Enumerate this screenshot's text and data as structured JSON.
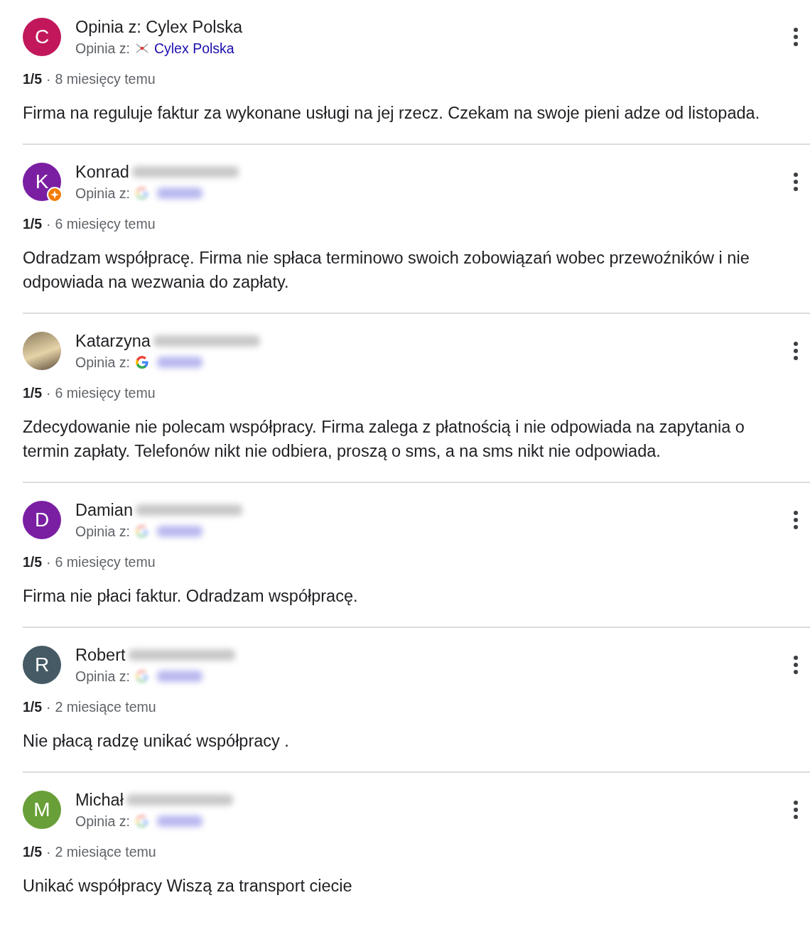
{
  "reviews": [
    {
      "avatar": {
        "kind": "letter",
        "letter": "C",
        "color": "#c2185b"
      },
      "name": "Opinia z: Cylex Polska",
      "source": {
        "label": "Opinia z:",
        "kind": "cylex",
        "name": "Cylex Polska"
      },
      "rating": "1/5",
      "separator": "·",
      "time": "8 miesięcy temu",
      "text": "Firma na reguluje faktur za wykonane usługi na jej rzecz. Czekam na swoje pieni adze od listopada."
    },
    {
      "avatar": {
        "kind": "letter",
        "letter": "K",
        "color": "#7b1fa2",
        "badge": true
      },
      "name": "Konrad",
      "surname_blurred": true,
      "source": {
        "label": "Opinia z:",
        "kind": "google",
        "blurred": true
      },
      "rating": "1/5",
      "separator": "·",
      "time": "6 miesięcy temu",
      "text": "Odradzam współpracę. Firma nie spłaca terminowo swoich zobowiązań wobec przewoźników i nie odpowiada na wezwania do zapłaty."
    },
    {
      "avatar": {
        "kind": "photo"
      },
      "name": "Katarzyna",
      "surname_blurred": true,
      "source": {
        "label": "Opinia z:",
        "kind": "google",
        "blurred": false
      },
      "rating": "1/5",
      "separator": "·",
      "time": "6 miesięcy temu",
      "text": "Zdecydowanie nie polecam współpracy. Firma zalega z płatnością i nie odpowiada na zapytania o termin zapłaty. Telefonów nikt nie odbiera, proszą o sms, a na sms nikt nie odpowiada."
    },
    {
      "avatar": {
        "kind": "letter",
        "letter": "D",
        "color": "#7b1fa2"
      },
      "name": "Damian",
      "surname_blurred": true,
      "source": {
        "label": "Opinia z:",
        "kind": "google",
        "blurred": true
      },
      "rating": "1/5",
      "separator": "·",
      "time": "6 miesięcy temu",
      "text": "Firma nie płaci faktur. Odradzam współpracę."
    },
    {
      "avatar": {
        "kind": "letter",
        "letter": "R",
        "color": "#455a64"
      },
      "name": "Robert",
      "surname_blurred": true,
      "source": {
        "label": "Opinia z:",
        "kind": "google",
        "blurred": true
      },
      "rating": "1/5",
      "separator": "·",
      "time": "2 miesiące temu",
      "text": "Nie płacą radzę unikać współpracy ."
    },
    {
      "avatar": {
        "kind": "letter",
        "letter": "M",
        "color": "#689f38"
      },
      "name": "Michał",
      "surname_blurred": true,
      "source": {
        "label": "Opinia z:",
        "kind": "google",
        "blurred": true
      },
      "rating": "1/5",
      "separator": "·",
      "time": "2 miesiące temu",
      "text": "Unikać współpracy Wiszą za transport ciecie"
    }
  ]
}
